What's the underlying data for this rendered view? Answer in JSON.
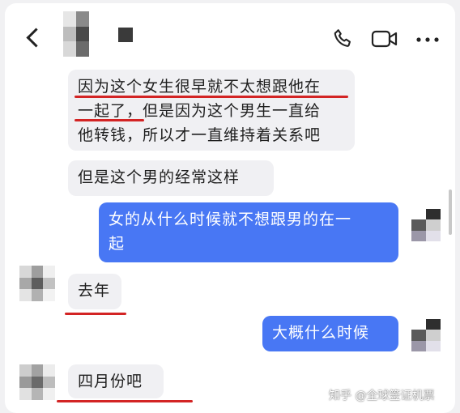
{
  "header": {
    "back_icon": "chevron-left-icon",
    "call_icon": "phone-icon",
    "video_icon": "video-camera-icon",
    "more_icon": "more-horizontal-icon"
  },
  "messages": [
    {
      "from": "other",
      "lines": [
        "因为这个女生很早就不太想跟他在",
        "一起了，但是因为这个男生一直给",
        "他转钱，所以才一直维持着关系吧"
      ]
    },
    {
      "from": "other",
      "lines": [
        "但是这个男的经常这样"
      ]
    },
    {
      "from": "me",
      "lines": [
        "女的从什么时候就不想跟男的在一",
        "起"
      ]
    },
    {
      "from": "other",
      "lines": [
        "去年"
      ]
    },
    {
      "from": "me",
      "lines": [
        "大概什么时候"
      ]
    },
    {
      "from": "other",
      "lines": [
        "四月份吧"
      ]
    }
  ],
  "watermark": "知乎 @全球签证机票",
  "colors": {
    "sent_bubble": "#4877f4",
    "received_bubble": "#f0f0f3",
    "highlight_underline": "#d32424"
  }
}
